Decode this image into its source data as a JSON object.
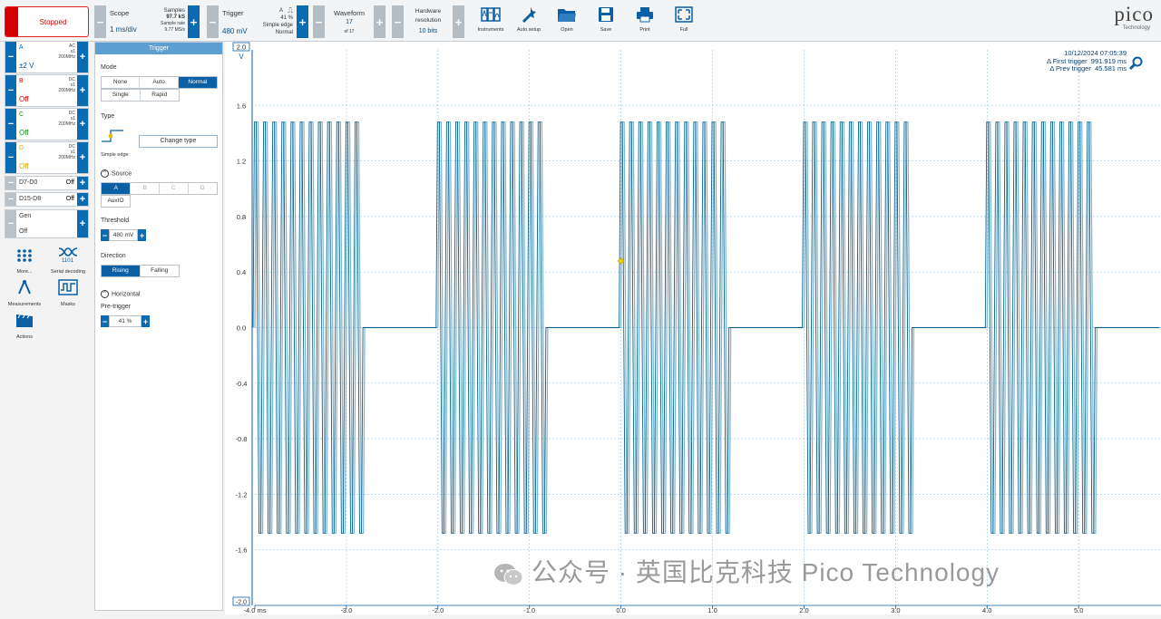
{
  "status": {
    "label": "Stopped"
  },
  "scope": {
    "title": "Scope",
    "value": "1 ms/div",
    "samples_label": "Samples",
    "samples_value": "97.7 kS",
    "rate_label": "Sample rate",
    "rate_value": "9.77 MS/s"
  },
  "trigger": {
    "title": "Trigger",
    "value": "480 mV",
    "source": "A",
    "pre_pct": "41 %",
    "type": "Simple edge",
    "mode": "Normal"
  },
  "waveform": {
    "title": "Waveform",
    "value": "17",
    "of": "of 17"
  },
  "hardware": {
    "title_line1": "Hardware",
    "title_line2": "resolution",
    "value": "10 bits"
  },
  "tools": [
    {
      "label": "Instruments",
      "icon": "instruments-icon"
    },
    {
      "label": "Auto setup",
      "icon": "auto-setup-icon"
    },
    {
      "label": "Open",
      "icon": "open-folder-icon"
    },
    {
      "label": "Save",
      "icon": "save-icon"
    },
    {
      "label": "Print",
      "icon": "print-icon"
    },
    {
      "label": "Full",
      "icon": "fullscreen-icon"
    }
  ],
  "logo": {
    "text": "pico",
    "sub": "Technology"
  },
  "channels": [
    {
      "name": "A",
      "coupling": "AC",
      "probe": "x1",
      "bw": "200MHz",
      "value": "±2 V",
      "color": "#0a6bb0"
    },
    {
      "name": "B",
      "coupling": "DC",
      "probe": "x1",
      "bw": "200MHz",
      "value": "Off",
      "color": "#d40000"
    },
    {
      "name": "C",
      "coupling": "DC",
      "probe": "x1",
      "bw": "200MHz",
      "value": "Off",
      "color": "#1a8a1a"
    },
    {
      "name": "D",
      "coupling": "DC",
      "probe": "x1",
      "bw": "200MHz",
      "value": "Off",
      "color": "#d6a400"
    }
  ],
  "digital": [
    {
      "name": "D7-D0",
      "value": "Off"
    },
    {
      "name": "D15-D8",
      "value": "Off"
    }
  ],
  "gen": {
    "name": "Gen",
    "value": "Off"
  },
  "left_tools": [
    {
      "label": "More...",
      "icon": "more-grid-icon"
    },
    {
      "label": "Serial decoding",
      "icon": "serial-decoding-icon"
    },
    {
      "label": "Measurements",
      "icon": "measurements-icon"
    },
    {
      "label": "Masks",
      "icon": "masks-icon"
    },
    {
      "label": "Actions",
      "icon": "actions-icon"
    }
  ],
  "panel": {
    "title": "Trigger",
    "mode_label": "Mode",
    "modes": [
      "None",
      "Auto",
      "Normal",
      "Single",
      "Rapid"
    ],
    "mode_selected": "Normal",
    "type_label": "Type",
    "type_caption": "Simple edge",
    "change_type": "Change type",
    "source_label": "Source",
    "sources": [
      "A",
      "B",
      "C",
      "D"
    ],
    "source_selected": "A",
    "aux": "AuxIO",
    "threshold_label": "Threshold",
    "threshold_value": "480 mV",
    "direction_label": "Direction",
    "directions": [
      "Rising",
      "Falling"
    ],
    "direction_selected": "Rising",
    "horizontal_label": "Horizontal",
    "pretrigger_label": "Pre-trigger",
    "pretrigger_value": "41 %"
  },
  "readout": {
    "timestamp": "10/12/2024 07:05:39",
    "first_label": "Δ First trigger",
    "first_value": "991.919 ms",
    "prev_label": "Δ Prev trigger",
    "prev_value": "45.581 ms"
  },
  "axis": {
    "unit": "V",
    "top_label": "2.0",
    "bottom_label": "-2.0",
    "x_first_label": "-4.0 ms"
  },
  "watermark": "公众号 · 英国比克科技 Pico Technology",
  "chart_data": {
    "type": "line",
    "series": [
      {
        "x_bursts": [
          [
            -4.0,
            -2.8
          ],
          [
            -2.0,
            -0.8
          ],
          [
            0.0,
            1.2
          ],
          [
            2.0,
            3.2
          ],
          [
            4.0,
            5.2
          ]
        ],
        "y_range": [
          -1.48,
          1.48
        ],
        "baseline": 0.0
      }
    ],
    "x_unit": "ms",
    "xlim": [
      -4.0,
      5.9
    ],
    "ylim": [
      -2.0,
      2.0
    ],
    "xticks": [
      -4.0,
      -3.0,
      -2.0,
      -1.0,
      0.0,
      1.0,
      2.0,
      3.0,
      4.0,
      5.0
    ],
    "xtick_labels": [
      "-4.0 ms",
      "-3.0",
      "-2.0",
      "-1.0",
      "0.0",
      "1.0",
      "2.0",
      "3.0",
      "4.0",
      "5.0"
    ],
    "yticks": [
      1.6,
      1.2,
      0.8,
      0.4,
      0.0,
      -0.4,
      -0.8,
      -1.2,
      -1.6
    ],
    "ytick_labels": [
      "1.6",
      "1.2",
      "0.8",
      "0.4",
      "0.0",
      "-0.4",
      "-0.8",
      "-1.2",
      "-1.6"
    ],
    "grid": true,
    "trigger_marker": {
      "x": 0.0,
      "y": 0.48
    },
    "trace_colors": [
      "#0d5f8a",
      "#7bb5cf"
    ]
  }
}
